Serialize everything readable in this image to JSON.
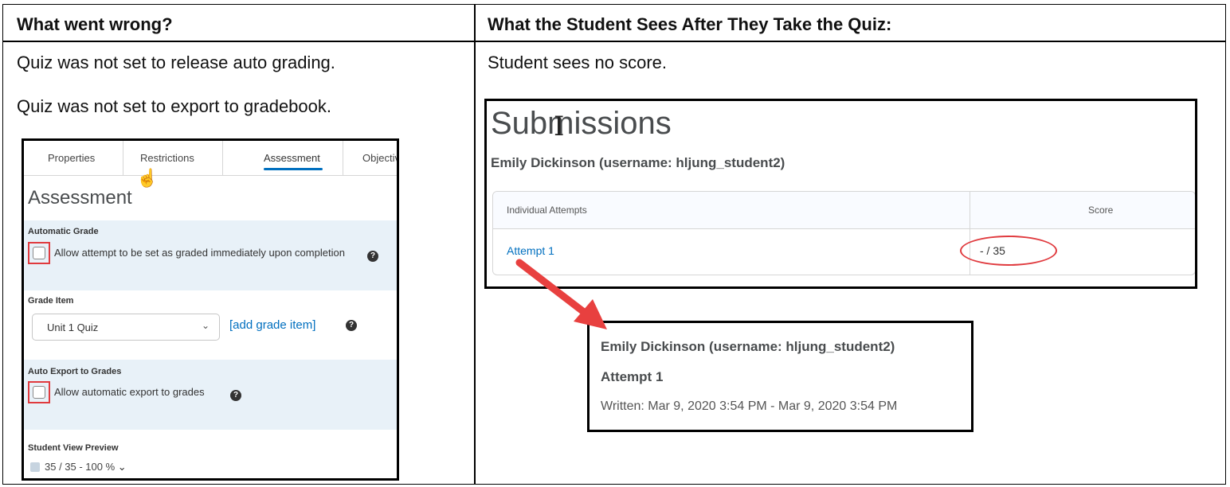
{
  "table": {
    "header_left": "What went wrong?",
    "header_right": "What the Student Sees After They Take the Quiz:",
    "left_line1": "Quiz was not set to release auto grading.",
    "left_line2": "Quiz was not set to export to gradebook.",
    "right_line1": "Student sees no score."
  },
  "assessment_panel": {
    "tabs": [
      "Properties",
      "Restrictions",
      "Assessment",
      "Objectives"
    ],
    "title": "Assessment",
    "automatic_grade_label": "Automatic Grade",
    "automatic_grade_option": "Allow attempt to be set as graded immediately upon completion",
    "grade_item_label": "Grade Item",
    "grade_item_selected": "Unit 1 Quiz",
    "add_grade_item": "[add grade item]",
    "auto_export_label": "Auto Export to Grades",
    "auto_export_option": "Allow automatic export to grades",
    "preview_label": "Student View Preview",
    "preview_score": "35 / 35 - 100 %"
  },
  "submissions_panel": {
    "title": "Submissions",
    "student": "Emily Dickinson (username: hljung_student2)",
    "col_attempts": "Individual Attempts",
    "col_score": "Score",
    "attempt_link": "Attempt 1",
    "score": "- / 35"
  },
  "attempt_detail": {
    "student": "Emily Dickinson (username: hljung_student2)",
    "attempt": "Attempt 1",
    "written": "Written: Mar 9, 2020 3:54 PM - Mar 9, 2020 3:54 PM"
  },
  "colors": {
    "highlight_red": "#e03a3e",
    "link_blue": "#006fbf",
    "section_blue": "#e8f1f8"
  }
}
